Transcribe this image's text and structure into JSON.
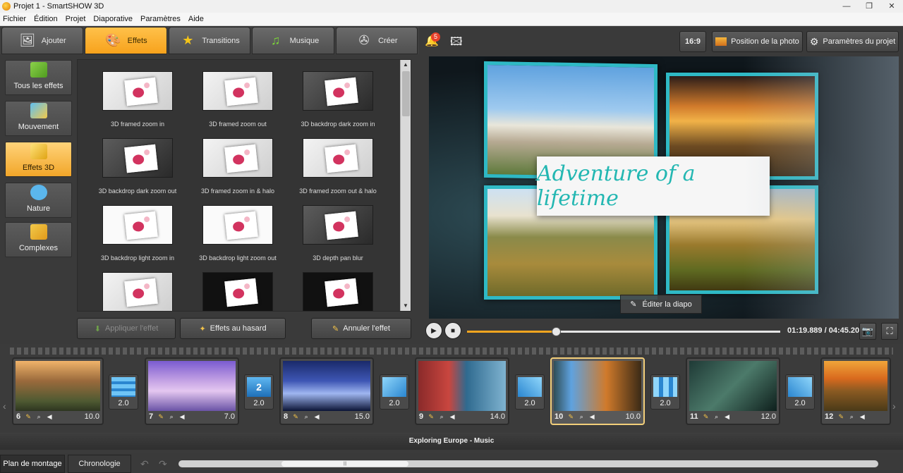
{
  "window": {
    "title": "Projet 1 - SmartSHOW 3D",
    "controls": [
      "—",
      "❐",
      "✕"
    ]
  },
  "menu": [
    "Fichier",
    "Édition",
    "Projet",
    "Diaporative",
    "Paramètres",
    "Aide"
  ],
  "top_tabs": [
    {
      "label": "Ajouter",
      "icon": "photo-add-icon",
      "active": false
    },
    {
      "label": "Effets",
      "icon": "palette-icon",
      "active": true
    },
    {
      "label": "Transitions",
      "icon": "star-icon",
      "active": false
    },
    {
      "label": "Musique",
      "icon": "music-note-icon",
      "active": false
    },
    {
      "label": "Créer",
      "icon": "film-reel-icon",
      "active": false
    }
  ],
  "categories": [
    {
      "label": "Tous les effets",
      "active": false
    },
    {
      "label": "Mouvement",
      "active": false
    },
    {
      "label": "Effets 3D",
      "active": true
    },
    {
      "label": "Nature",
      "active": false
    },
    {
      "label": "Complexes",
      "active": false
    }
  ],
  "effects": [
    {
      "label": "3D framed zoom in"
    },
    {
      "label": "3D framed zoom out"
    },
    {
      "label": "3D backdrop dark zoom in"
    },
    {
      "label": "3D backdrop dark zoom out"
    },
    {
      "label": "3D framed zoom in & halo"
    },
    {
      "label": "3D framed zoom out & halo"
    },
    {
      "label": "3D backdrop light zoom in"
    },
    {
      "label": "3D backdrop light zoom out"
    },
    {
      "label": "3D depth pan blur"
    },
    {
      "label": ""
    },
    {
      "label": ""
    },
    {
      "label": ""
    }
  ],
  "actions": {
    "apply": "Appliquer l'effet",
    "random": "Effets au hasard",
    "cancel": "Annuler l'effet"
  },
  "toolbar": {
    "notifications_count": "5",
    "aspect": "16:9",
    "photo_position": "Position de la photo",
    "project_settings": "Paramètres du projet"
  },
  "preview": {
    "title_text": "Adventure of a lifetime",
    "edit_button": "Éditer la diapo"
  },
  "player": {
    "time": "01:19.889 / 04:45.200",
    "progress": 0.283
  },
  "slides": [
    {
      "num": "6",
      "duration": "10.0",
      "selected": false
    },
    {
      "num": "7",
      "duration": "7.0",
      "selected": false
    },
    {
      "num": "8",
      "duration": "15.0",
      "selected": false
    },
    {
      "num": "9",
      "duration": "14.0",
      "selected": false
    },
    {
      "num": "10",
      "duration": "10.0",
      "selected": true
    },
    {
      "num": "11",
      "duration": "12.0",
      "selected": false
    },
    {
      "num": "12",
      "duration": "",
      "selected": false
    }
  ],
  "transitions": [
    {
      "duration": "2.0"
    },
    {
      "duration": "2.0",
      "badge": "2"
    },
    {
      "duration": "2.0"
    },
    {
      "duration": "2.0"
    },
    {
      "duration": "2.0"
    },
    {
      "duration": "2.0"
    }
  ],
  "music_track": "Exploring Europe - Music",
  "bottom_tabs": {
    "storyboard": "Plan de montage",
    "timeline": "Chronologie"
  }
}
